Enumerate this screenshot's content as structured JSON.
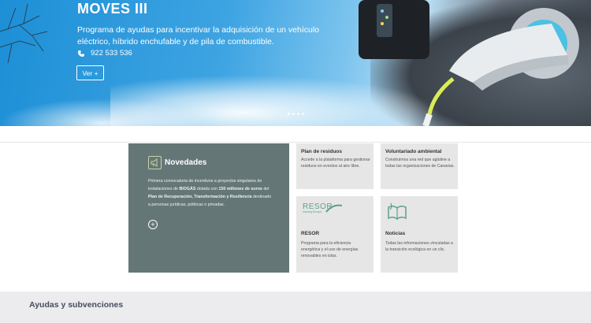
{
  "hero": {
    "title": "MOVES III",
    "description": "Programa de ayudas para incentivar la adquisición de un vehículo eléctrico, híbrido enchufable y de pila de combustible.",
    "phone": "922 533 536",
    "button_label": "Ver +",
    "icons": [
      "phone-icon"
    ]
  },
  "featured": {
    "title": "Novedades",
    "text_parts": {
      "p1": "Primera convocatoria de incentivos a proyectos singulares de instalaciones de ",
      "b1": "BIOGÁS",
      "p2": " dotada con ",
      "b2": "150 millones de euros",
      "p3": " del ",
      "b3": "Plan de Recuperación, Transformación y Resiliencia",
      "p4": " destinado a personas jurídicas, públicas o privadas."
    },
    "more_label": "+",
    "icons": [
      "megaphone-icon"
    ]
  },
  "tiles": [
    {
      "title": "Plan de residuos",
      "description": "Accede a la plataforma para gestionar residuos en eventos al aire libre."
    },
    {
      "title": "Voluntariado ambiental",
      "description": "Construimos una red que aglutine a todas las organizaciones de Canarias."
    },
    {
      "title": "RESOR",
      "logo_text": "RESOR",
      "logo_subtext": "Interreg Europe",
      "description": "Programa para la eficiencia energética y el uso de energías renovables en islas."
    },
    {
      "title": "Noticias",
      "description": "Todas las informaciones vinculadas a la transición ecológica en un clic."
    }
  ],
  "bottom": {
    "label": "Ayudas y subvenciones"
  },
  "colors": {
    "featured_bg": "#657677",
    "tile_bg": "#e6e6e6",
    "accent_green": "#5f9e8e",
    "bottom_bar_bg": "#ececef"
  }
}
